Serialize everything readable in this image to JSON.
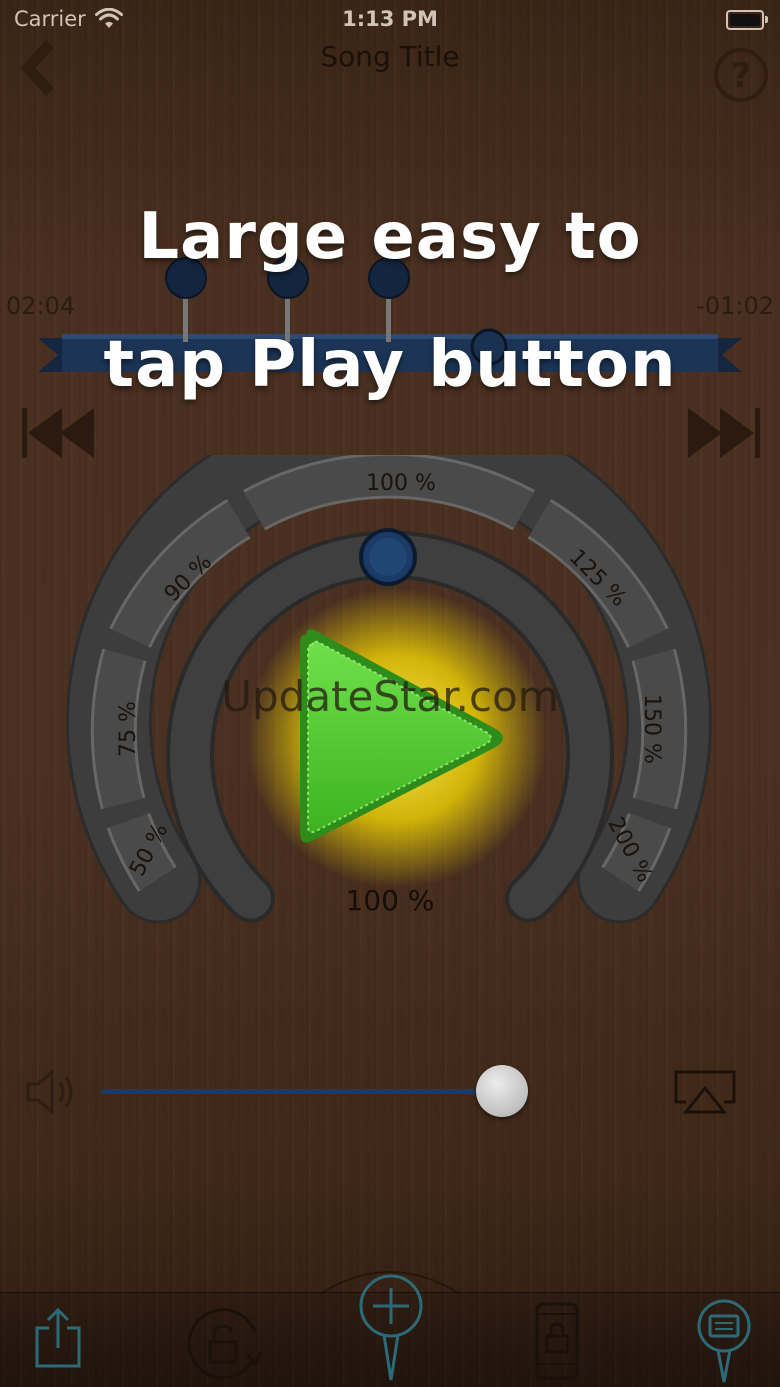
{
  "status_bar": {
    "carrier": "Carrier",
    "time": "1:13 PM"
  },
  "nav": {
    "title": "Song Title",
    "back_icon": "chevron-left-icon",
    "help_icon": "question-mark-icon"
  },
  "headline": {
    "line1": "Large easy to",
    "line2": "tap Play button"
  },
  "progress": {
    "elapsed": "02:04",
    "remaining": "-01:02"
  },
  "speed_dial": {
    "labels": [
      "50 %",
      "75 %",
      "90 %",
      "100 %",
      "125 %",
      "150 %",
      "200 %"
    ],
    "current": "100 %"
  },
  "watermark": "UpdateStar.com",
  "volume": {
    "level": 0.85
  },
  "colors": {
    "play_green": "#4ec82e",
    "glow": "#ffe000",
    "marker_blue": "#1c3a66",
    "dial_gray": "#3e3e3e"
  },
  "icons": {
    "rewind": "skip-back-icon",
    "forward": "skip-forward-icon",
    "speaker": "speaker-icon",
    "airplay": "airplay-icon",
    "share": "share-icon",
    "rotation_lock": "rotation-lock-icon",
    "add_marker": "add-marker-icon",
    "screen_lock": "screen-lock-icon",
    "markers": "marker-list-icon"
  }
}
